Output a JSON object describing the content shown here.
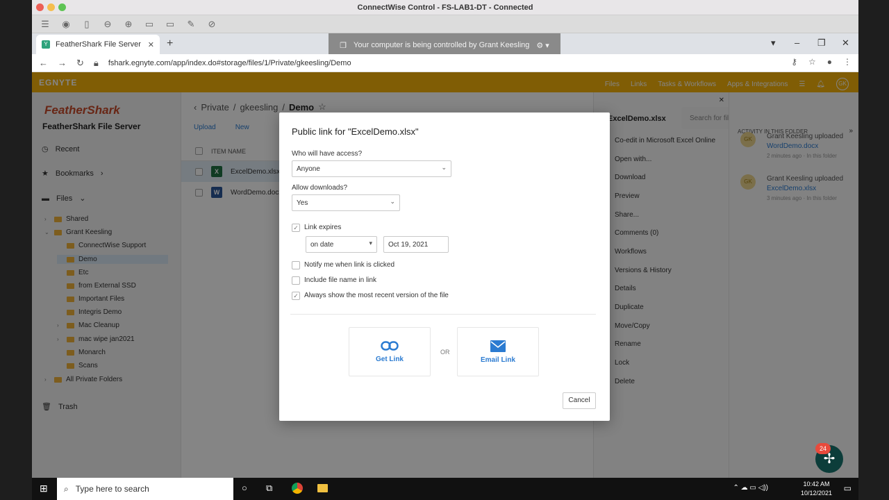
{
  "window": {
    "title": "ConnectWise Control - FS-LAB1-DT - Connected"
  },
  "cw_toolbar": {
    "icons": [
      "menu-icon",
      "camera-icon",
      "book-icon",
      "zoom-out-icon",
      "zoom-in-icon",
      "file-icon",
      "file2-icon",
      "pen-icon",
      "eye-off-icon"
    ]
  },
  "browser": {
    "tab_title": "FeatherShark File Server",
    "url": "fshark.egnyte.com/app/index.do#storage/files/1/Private/gkeesling/Demo",
    "control_banner": "Your computer is being controlled by Grant Keesling"
  },
  "egnyte": {
    "logo": "EGNYTE",
    "nav": [
      "Files",
      "Links",
      "Tasks & Workflows",
      "Apps & Integrations"
    ],
    "avatar": "GK",
    "brand_logo": "FeatherShark",
    "brand_name": "FeatherShark File Server",
    "sidebar": {
      "recent": "Recent",
      "bookmarks": "Bookmarks",
      "files": "Files",
      "trash": "Trash",
      "tree": [
        "Shared",
        "Grant Keesling",
        "ConnectWise Support",
        "Demo",
        "Etc",
        "from External SSD",
        "Important Files",
        "Integris Demo",
        "Mac Cleanup",
        "mac wipe jan2021",
        "Monarch",
        "Scans",
        "All Private Folders"
      ]
    },
    "breadcrumb": {
      "p1": "Private",
      "p2": "gkeesling",
      "current": "Demo"
    },
    "toolbar": {
      "upload": "Upload",
      "new": "New"
    },
    "list": {
      "header": "ITEM NAME",
      "rows": [
        "ExcelDemo.xlsx",
        "WordDemo.docx"
      ]
    },
    "search_placeholder": "Search for files and folders...",
    "details": {
      "title": "ExcelDemo.xlsx",
      "actions": [
        "Co-edit in Microsoft Excel Online",
        "Open with...",
        "Download",
        "Preview",
        "Share...",
        "Comments (0)",
        "Workflows",
        "Versions & History",
        "Details",
        "Duplicate",
        "Move/Copy",
        "Rename",
        "Lock",
        "Delete"
      ]
    },
    "activity": {
      "header": "ACTIVITY IN THIS FOLDER",
      "items": [
        {
          "user": "Grant Keesling",
          "verb": "uploaded",
          "file": "WordDemo.docx",
          "time": "2 minutes ago",
          "where": "In this folder"
        },
        {
          "user": "Grant Keesling",
          "verb": "uploaded",
          "file": "ExcelDemo.xlsx",
          "time": "3 minutes ago",
          "where": "In this folder"
        }
      ]
    },
    "fab_badge": "24"
  },
  "modal": {
    "title": "Public link for \"ExcelDemo.xlsx\"",
    "access_label": "Who will have access?",
    "access_value": "Anyone",
    "downloads_label": "Allow downloads?",
    "downloads_value": "Yes",
    "link_expires": "Link expires",
    "expire_mode": "on date",
    "expire_date": "Oct 19, 2021",
    "notify": "Notify me when link is clicked",
    "include_name": "Include file name in link",
    "recent_version": "Always show the most recent version of the file",
    "get_link": "Get Link",
    "or": "OR",
    "email_link": "Email Link",
    "cancel": "Cancel"
  },
  "taskbar": {
    "search": "Type here to search",
    "time": "10:42 AM",
    "date": "10/12/2021"
  }
}
